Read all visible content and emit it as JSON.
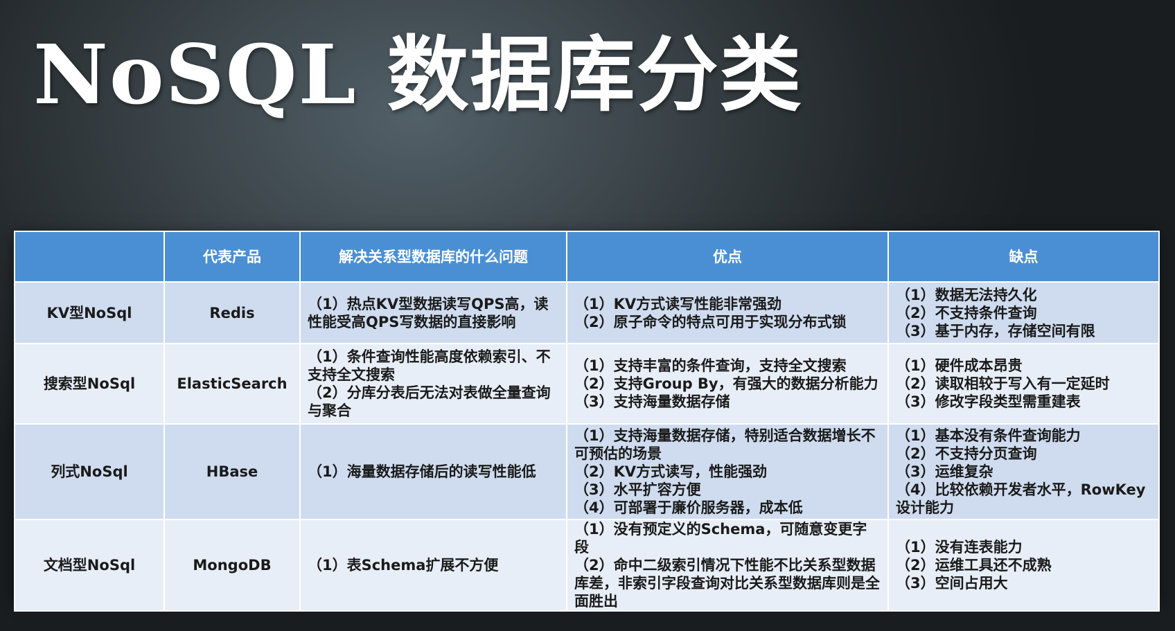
{
  "title": "NoSQL 数据库分类",
  "table": {
    "headers": [
      "",
      "代表产品",
      "解决关系型数据库的什么问题",
      "优点",
      "缺点"
    ],
    "rows": [
      {
        "type": "KV型NoSql",
        "product": "Redis",
        "problem": [
          "（1）热点KV型数据读写QPS高，读性能受高QPS写数据的直接影响"
        ],
        "pros": [
          "（1）KV方式读写性能非常强劲",
          "（2）原子命令的特点可用于实现分布式锁"
        ],
        "cons": [
          "（1）数据无法持久化",
          "（2）不支持条件查询",
          "（3）基于内存，存储空间有限"
        ]
      },
      {
        "type": "搜索型NoSql",
        "product": "ElasticSearch",
        "problem": [
          "（1）条件查询性能高度依赖索引、不支持全文搜索",
          "（2）分库分表后无法对表做全量查询与聚合"
        ],
        "pros": [
          "（1）支持丰富的条件查询，支持全文搜索",
          "（2）支持Group By，有强大的数据分析能力",
          "（3）支持海量数据存储"
        ],
        "cons": [
          "（1）硬件成本昂贵",
          "（2）读取相较于写入有一定延时",
          "（3）修改字段类型需重建表"
        ]
      },
      {
        "type": "列式NoSql",
        "product": "HBase",
        "problem": [
          "（1）海量数据存储后的读写性能低"
        ],
        "pros": [
          "（1）支持海量数据存储，特别适合数据增长不可预估的场景",
          "（2）KV方式读写，性能强劲",
          "（3）水平扩容方便",
          "（4）可部署于廉价服务器，成本低"
        ],
        "cons": [
          "（1）基本没有条件查询能力",
          "（2）不支持分页查询",
          "（3）运维复杂",
          "（4）比较依赖开发者水平，RowKey设计能力"
        ]
      },
      {
        "type": "文档型NoSql",
        "product": "MongoDB",
        "problem": [
          "（1）表Schema扩展不方便"
        ],
        "pros": [
          "（1）没有预定义的Schema，可随意变更字段",
          "（2）命中二级索引情况下性能不比关系型数据库差，非索引字段查询对比关系型数据库则是全面胜出"
        ],
        "cons": [
          "（1）没有连表能力",
          "（2）运维工具还不成熟",
          "（3）空间占用大"
        ]
      }
    ]
  }
}
